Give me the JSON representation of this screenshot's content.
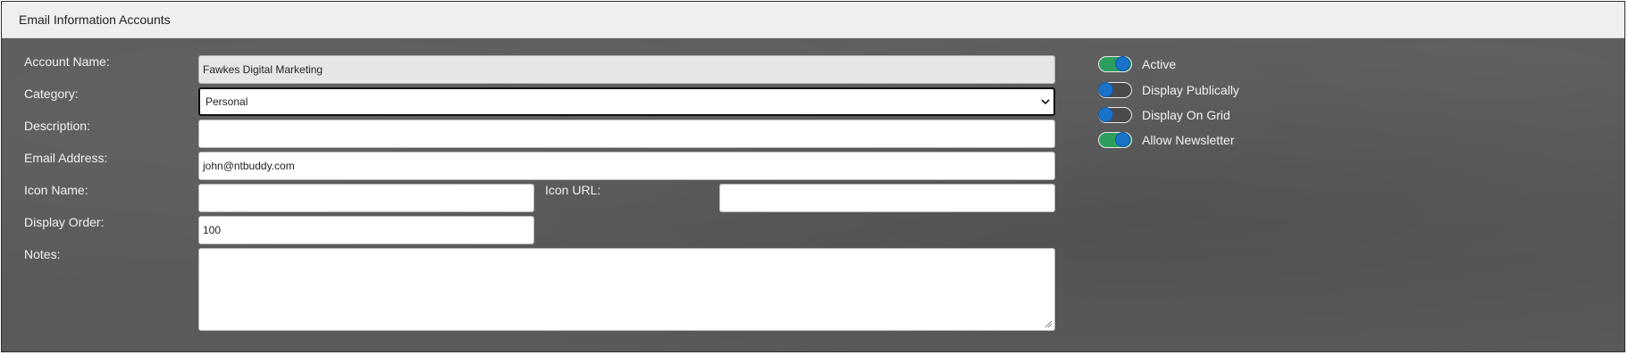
{
  "header": {
    "title": "Email Information Accounts"
  },
  "form": {
    "account_name": {
      "label": "Account Name:",
      "value": "Fawkes Digital Marketing"
    },
    "category": {
      "label": "Category:",
      "value": "Personal"
    },
    "description": {
      "label": "Description:",
      "value": ""
    },
    "email_address": {
      "label": "Email Address:",
      "value": "john@ntbuddy.com"
    },
    "icon_name": {
      "label": "Icon Name:",
      "value": ""
    },
    "icon_url": {
      "label": "Icon URL:",
      "value": ""
    },
    "display_order": {
      "label": "Display Order:",
      "value": "100"
    },
    "notes": {
      "label": "Notes:",
      "value": ""
    }
  },
  "toggles": [
    {
      "label": "Active",
      "on": true
    },
    {
      "label": "Display Publically",
      "on": false
    },
    {
      "label": "Display On Grid",
      "on": false
    },
    {
      "label": "Allow Newsletter",
      "on": true
    }
  ],
  "colors": {
    "header_bg": "#efefef",
    "panel_bg": "#5a5a5a",
    "toggle_on": "#2e9e5e",
    "toggle_knob": "#1a73c8"
  }
}
